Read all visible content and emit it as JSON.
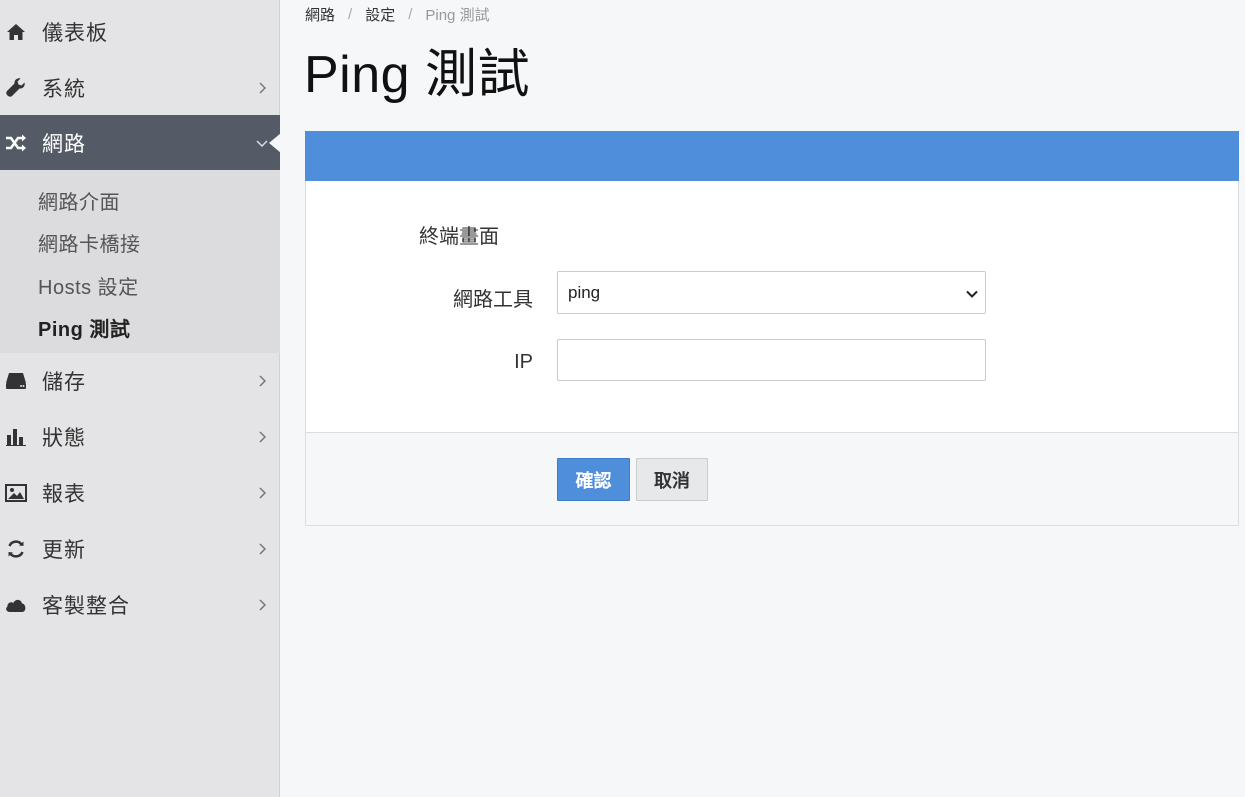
{
  "sidebar": {
    "items": [
      {
        "label": "儀表板",
        "icon": "home-icon"
      },
      {
        "label": "系統",
        "icon": "wrench-icon"
      },
      {
        "label": "網路",
        "icon": "shuffle-icon"
      },
      {
        "label": "儲存",
        "icon": "hard-drive-icon"
      },
      {
        "label": "狀態",
        "icon": "bar-chart-icon"
      },
      {
        "label": "報表",
        "icon": "image-icon"
      },
      {
        "label": "更新",
        "icon": "refresh-icon"
      },
      {
        "label": "客製整合",
        "icon": "cloud-icon"
      }
    ],
    "network_submenu": [
      {
        "label": "網路介面"
      },
      {
        "label": "網路卡橋接"
      },
      {
        "label": "Hosts 設定"
      },
      {
        "label": "Ping 測試"
      }
    ]
  },
  "breadcrumb": [
    "網路",
    "設定",
    "Ping 測試"
  ],
  "page": {
    "title": "Ping 測試"
  },
  "form": {
    "terminal_label": "終端畫面",
    "tool_label": "網路工具",
    "tool_value": "ping",
    "ip_label": "IP",
    "ip_value": "",
    "ip_placeholder": ""
  },
  "buttons": {
    "confirm": "確認",
    "cancel": "取消"
  },
  "colors": {
    "accent": "#4f8edb",
    "sidebar_active": "#555b66"
  }
}
